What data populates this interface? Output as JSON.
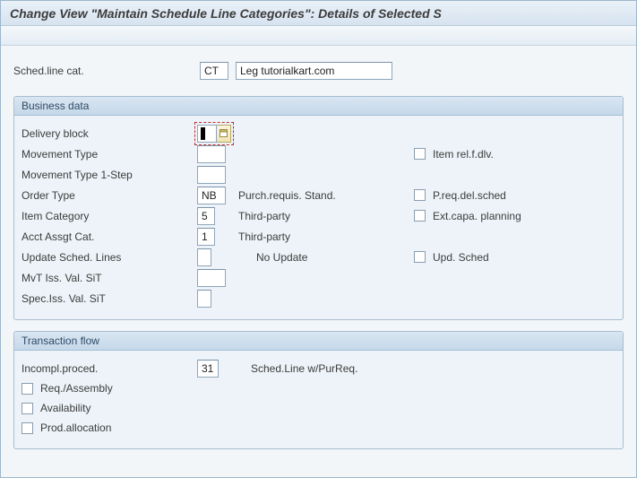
{
  "title": "Change View \"Maintain Schedule Line Categories\": Details of Selected S",
  "header": {
    "sched_line_cat_label": "Sched.line cat.",
    "sched_line_cat_value": "CT",
    "sched_line_cat_desc": "Leg tutorialkart.com"
  },
  "business": {
    "title": "Business data",
    "delivery_block_label": "Delivery block",
    "delivery_block_value": "",
    "movement_type_label": "Movement Type",
    "movement_type_value": "",
    "item_rel_f_dlv_label": "Item rel.f.dlv.",
    "movement_type_1step_label": "Movement Type 1-Step",
    "movement_type_1step_value": "",
    "order_type_label": "Order Type",
    "order_type_value": "NB",
    "order_type_desc": "Purch.requis. Stand.",
    "p_req_del_sched_label": "P.req.del.sched",
    "item_category_label": "Item Category",
    "item_category_value": "5",
    "item_category_desc": "Third-party",
    "ext_capa_planning_label": "Ext.capa. planning",
    "acct_assgt_cat_label": "Acct Assgt Cat.",
    "acct_assgt_cat_value": "1",
    "acct_assgt_cat_desc": "Third-party",
    "update_sched_lines_label": "Update Sched. Lines",
    "update_sched_lines_value": "",
    "update_sched_lines_desc": "No Update",
    "upd_sched_label": "Upd. Sched",
    "mvt_iss_val_sit_label": "MvT Iss. Val. SiT",
    "mvt_iss_val_sit_value": "",
    "spec_iss_val_sit_label": "Spec.Iss. Val. SiT",
    "spec_iss_val_sit_value": ""
  },
  "transaction": {
    "title": "Transaction flow",
    "incompl_proced_label": "Incompl.proced.",
    "incompl_proced_value": "31",
    "incompl_proced_desc": "Sched.Line w/PurReq.",
    "req_assembly_label": "Req./Assembly",
    "availability_label": "Availability",
    "prod_allocation_label": "Prod.allocation"
  }
}
